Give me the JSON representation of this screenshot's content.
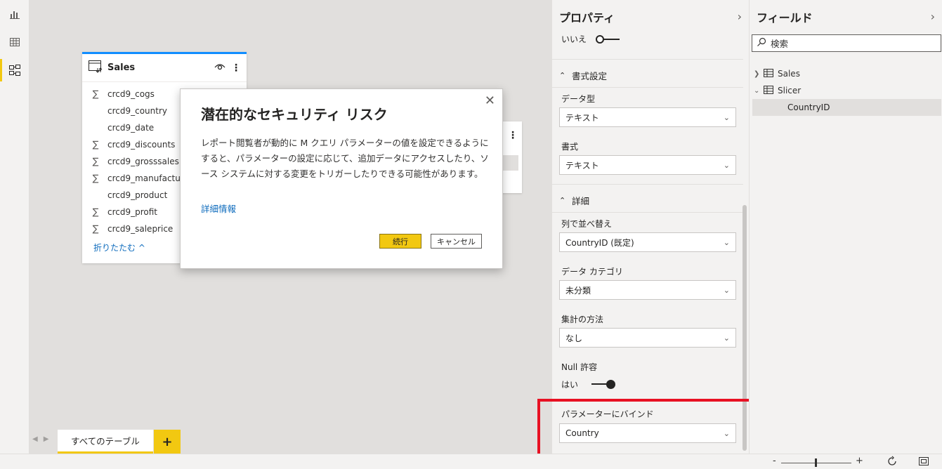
{
  "left_nav": {
    "items": [
      {
        "icon": "report-icon",
        "name": "nav-report"
      },
      {
        "icon": "data-icon",
        "name": "nav-data"
      },
      {
        "icon": "model-icon",
        "name": "nav-model",
        "active": true
      }
    ]
  },
  "table_card": {
    "title": "Sales",
    "fields": [
      {
        "name": "crcd9_cogs",
        "sigma": true
      },
      {
        "name": "crcd9_country",
        "sigma": false
      },
      {
        "name": "crcd9_date",
        "sigma": false
      },
      {
        "name": "crcd9_discounts",
        "sigma": true
      },
      {
        "name": "crcd9_grosssales",
        "sigma": true
      },
      {
        "name": "crcd9_manufacturin",
        "sigma": true
      },
      {
        "name": "crcd9_product",
        "sigma": false
      },
      {
        "name": "crcd9_profit",
        "sigma": true
      },
      {
        "name": "crcd9_saleprice",
        "sigma": true
      }
    ],
    "collapse_label": "折りたたむ ^"
  },
  "dialog": {
    "title": "潜在的なセキュリティ リスク",
    "body": "レポート閲覧者が動的に M クエリ パラメーターの値を設定できるようにすると、パラメーターの設定に応じて、追加データにアクセスしたり、ソース システムに対する変更をトリガーしたりできる可能性があります。",
    "link": "詳細情報",
    "primary_button": "続行",
    "secondary_button": "キャンセル"
  },
  "bottom_tabs": {
    "active_tab": "すべてのテーブル",
    "add": "+"
  },
  "properties": {
    "title": "プロパティ",
    "hidden_label": "いいえ",
    "format_section": "書式設定",
    "data_type_label": "データ型",
    "data_type_value": "テキスト",
    "format_label": "書式",
    "format_value": "テキスト",
    "detail_section": "詳細",
    "sort_by_label": "列で並べ替え",
    "sort_by_value": "CountryID (既定)",
    "data_category_label": "データ カテゴリ",
    "data_category_value": "未分類",
    "summarize_label": "集計の方法",
    "summarize_value": "なし",
    "nullable_label": "Null 許容",
    "nullable_value": "はい",
    "bind_param_label": "パラメーターにバインド",
    "bind_param_value": "Country"
  },
  "fields_pane": {
    "title": "フィールド",
    "search_placeholder": "検索",
    "tables": [
      {
        "name": "Sales",
        "expanded": false
      },
      {
        "name": "Slicer",
        "expanded": true,
        "columns": [
          "CountryID"
        ]
      }
    ]
  },
  "statusbar": {
    "zoom_minus": "-",
    "zoom_plus": "+"
  },
  "colors": {
    "accent_yellow": "#f2c811",
    "accent_blue": "#118dff",
    "highlight_red": "#e81123",
    "link_blue": "#0f6cbd"
  }
}
